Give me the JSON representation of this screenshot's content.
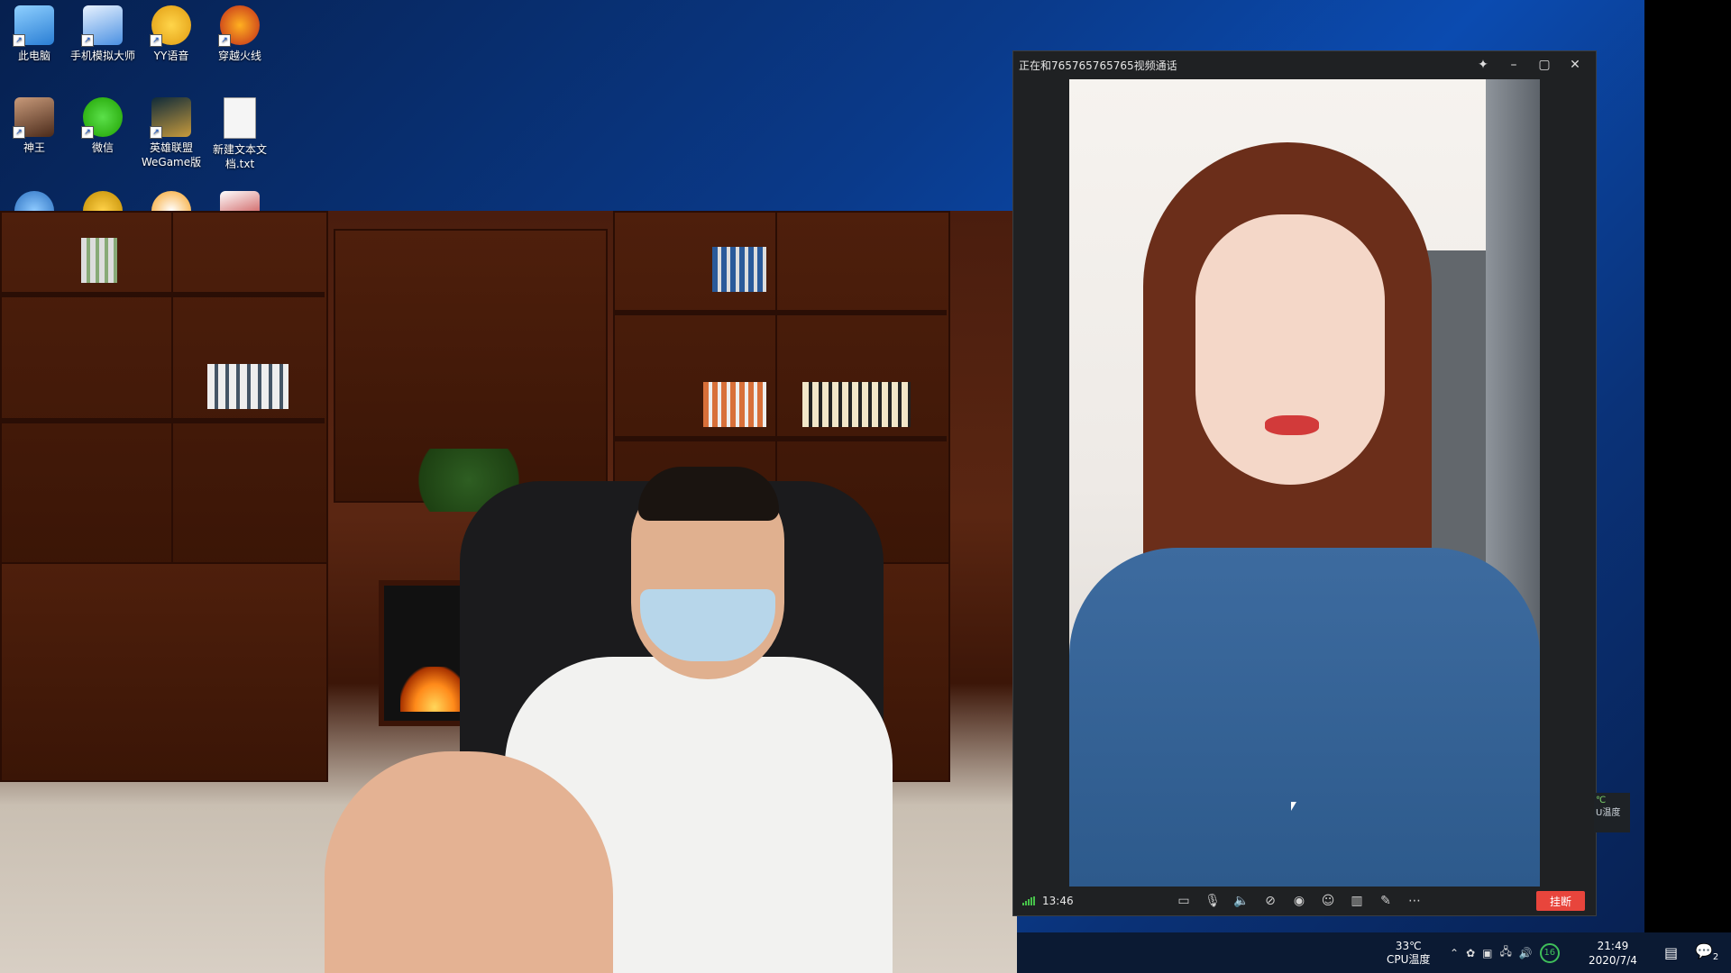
{
  "desktop": {
    "icons": [
      {
        "label": "此电脑",
        "icon": "computer-icon",
        "color": "#3a9be0"
      },
      {
        "label": "手机模拟大师",
        "icon": "phone-emulator-icon",
        "color": "#4a90e2"
      },
      {
        "label": "YY语音",
        "icon": "yy-voice-icon",
        "color": "#f2b515"
      },
      {
        "label": "穿越火线",
        "icon": "crossfire-icon",
        "color": "#d8331e"
      },
      {
        "label": "神王",
        "icon": "game-avatar-icon",
        "color": "#8a5a3a"
      },
      {
        "label": "微信",
        "icon": "wechat-icon",
        "color": "#2dc100"
      },
      {
        "label": "英雄联盟WeGame版",
        "icon": "lol-icon",
        "color": "#c89b3c"
      },
      {
        "label": "新建文本文档.txt",
        "icon": "text-file-icon",
        "color": "#f0f0f0"
      }
    ]
  },
  "call_window": {
    "title": "正在和765765765765视频通话",
    "duration": "13:46",
    "hangup_label": "挂断",
    "controls": [
      "chat-icon",
      "microphone-icon",
      "speaker-icon",
      "camera-off-icon",
      "screenshot-icon",
      "beauty-filter-icon",
      "layout-icon",
      "edit-icon",
      "more-icon"
    ]
  },
  "temp_widget": {
    "value": "℃",
    "label": "U温度"
  },
  "taskbar": {
    "cpu_temp": "33℃",
    "cpu_label": "CPU温度",
    "badge": "16",
    "time": "21:49",
    "date": "2020/7/4",
    "notif_count": "2"
  },
  "colors": {
    "hangup": "#e8453c",
    "signal": "#47c24a",
    "taskbar": "#0b1a33"
  }
}
